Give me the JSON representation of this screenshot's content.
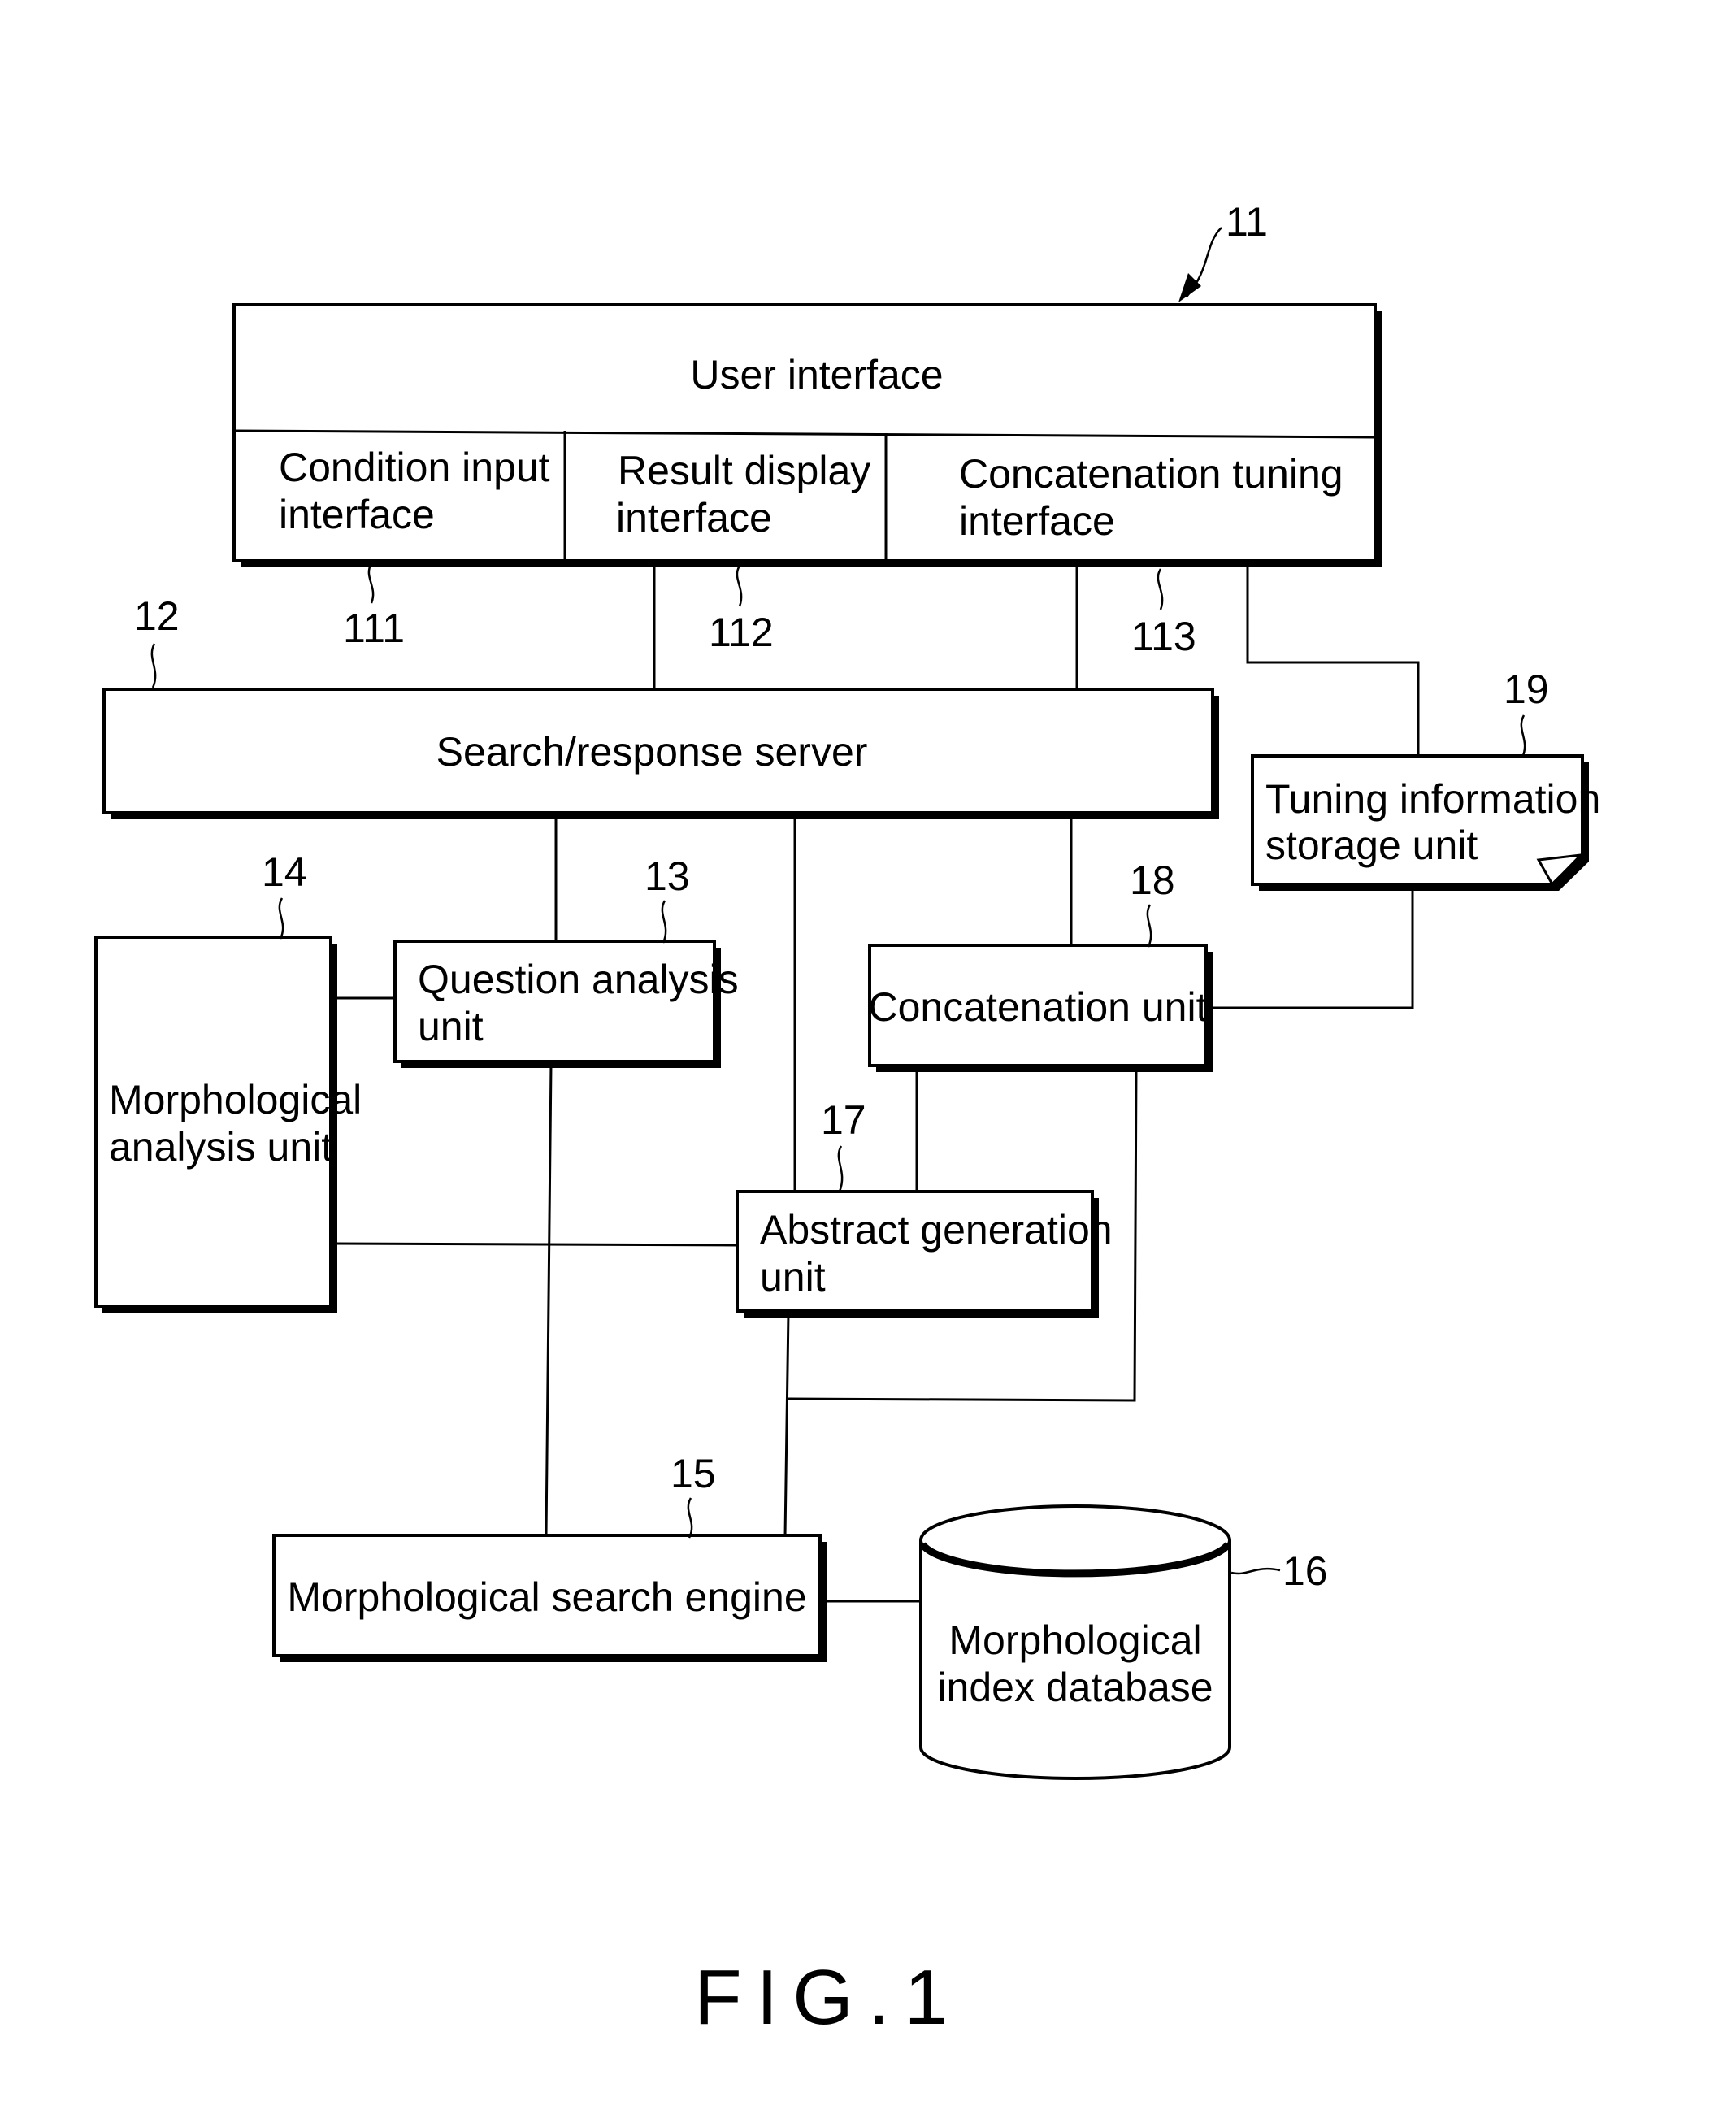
{
  "figure": {
    "caption": "FIG.1",
    "blocks": {
      "user_interface": {
        "ref": "11",
        "label": "User interface"
      },
      "condition_input": {
        "ref": "111",
        "line1": "Condition input",
        "line2": "interface"
      },
      "result_display": {
        "ref": "112",
        "line1": "Result display",
        "line2": "interface"
      },
      "concat_tuning": {
        "ref": "113",
        "line1": "Concatenation tuning",
        "line2": "interface"
      },
      "search_server": {
        "ref": "12",
        "label": "Search/response server"
      },
      "question_analysis": {
        "ref": "13",
        "line1": "Question analysis",
        "line2": "unit"
      },
      "morph_analysis": {
        "ref": "14",
        "line1": "Morphological",
        "line2": "analysis unit"
      },
      "morph_search": {
        "ref": "15",
        "label": "Morphological search engine"
      },
      "morph_index_db": {
        "ref": "16",
        "line1": "Morphological",
        "line2": "index database"
      },
      "abstract_gen": {
        "ref": "17",
        "line1": "Abstract generation",
        "line2": "unit"
      },
      "concat_unit": {
        "ref": "18",
        "label": "Concatenation unit"
      },
      "tuning_storage": {
        "ref": "19",
        "line1": "Tuning information",
        "line2": "storage unit"
      }
    }
  }
}
